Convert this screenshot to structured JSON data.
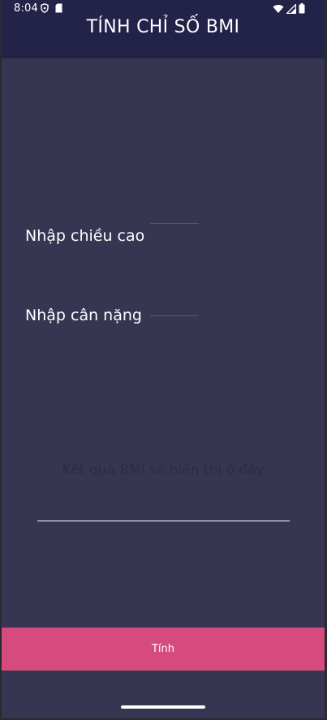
{
  "status_bar": {
    "time": "8:04",
    "icons": [
      "shield-icon",
      "sd-card-icon",
      "wifi-icon",
      "signal-icon",
      "battery-icon"
    ]
  },
  "app_bar": {
    "title": "TÍNH CHỈ SỐ BMI"
  },
  "form": {
    "height_label": "Nhập chiều cao",
    "height_value": "",
    "weight_label": "Nhập cân nặng",
    "weight_value": ""
  },
  "result": {
    "placeholder": "Kết quả BMI sẽ hiển thị ở đây"
  },
  "actions": {
    "calculate_label": "Tính"
  },
  "colors": {
    "background": "#363652",
    "app_bar": "#23234a",
    "button": "#d64b7e",
    "text": "#ffffff"
  }
}
